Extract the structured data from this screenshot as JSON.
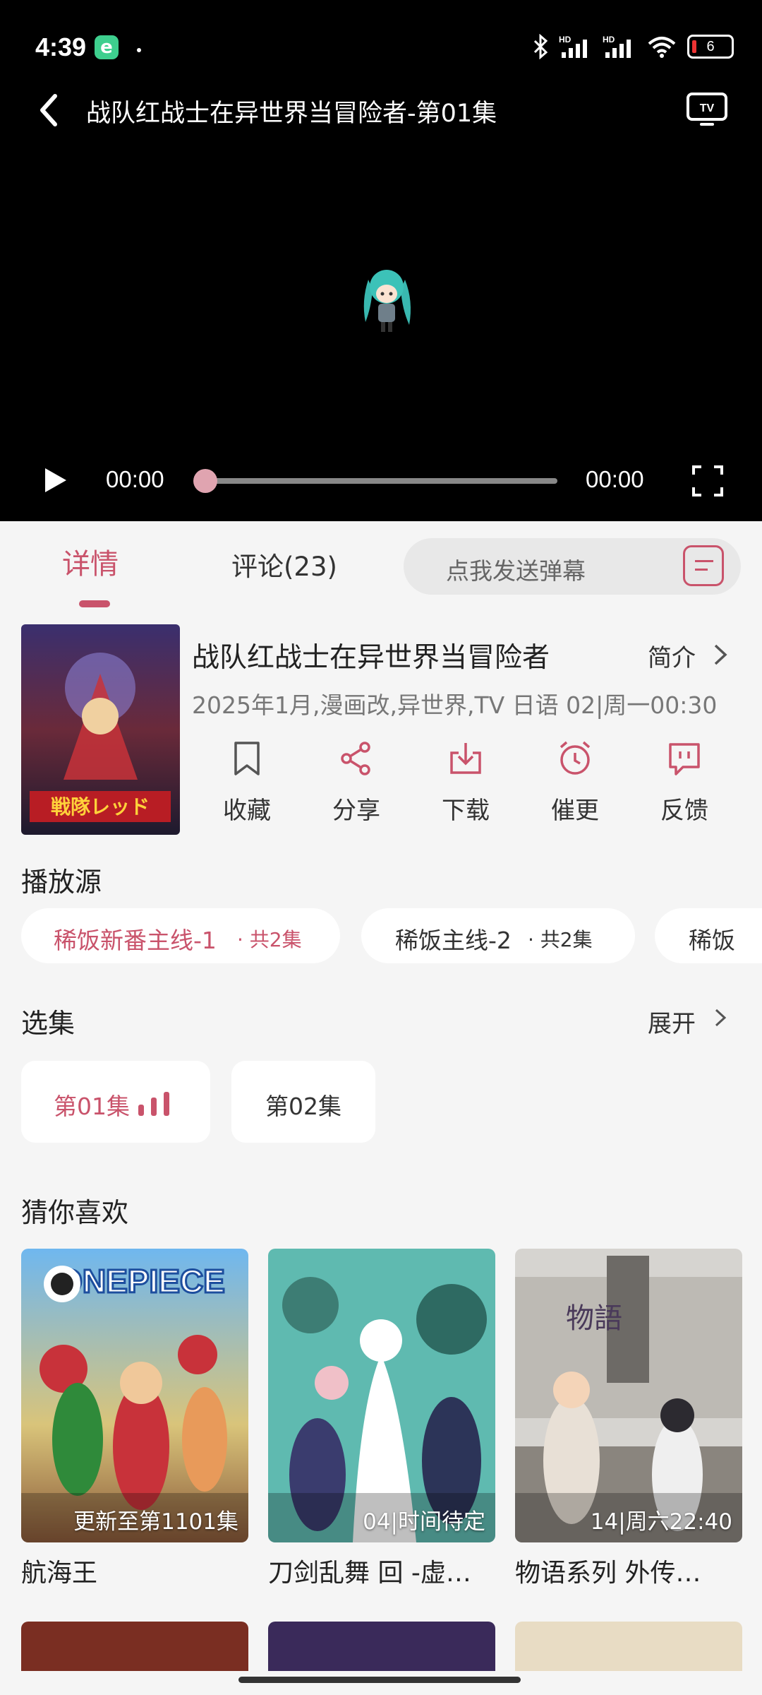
{
  "status_bar": {
    "time": "4:39",
    "app_icon_letter": "e",
    "battery": "6",
    "signal_labels": [
      "HD",
      "HD"
    ]
  },
  "player": {
    "title": "战队红战士在异世界当冒险者-第01集",
    "current_time": "00:00",
    "total_time": "00:00",
    "progress": 0
  },
  "tabs": {
    "details": "详情",
    "comments": "评论(23)",
    "danmu_placeholder": "点我发送弹幕"
  },
  "show": {
    "title": "战队红战士在异世界当冒险者",
    "intro_label": "简介",
    "meta": "2025年1月,漫画改,异世界,TV 日语 02|周一00:30",
    "poster_text": "戦隊レッド"
  },
  "actions": [
    {
      "label": "收藏",
      "icon": "bookmark-icon"
    },
    {
      "label": "分享",
      "icon": "share-icon"
    },
    {
      "label": "下载",
      "icon": "download-icon"
    },
    {
      "label": "催更",
      "icon": "alarm-clock-icon"
    },
    {
      "label": "反馈",
      "icon": "feedback-icon"
    }
  ],
  "sources": {
    "heading": "播放源",
    "items": [
      {
        "name": "稀饭新番主线-1",
        "count": "· 共2集",
        "active": true
      },
      {
        "name": "稀饭主线-2",
        "count": "· 共2集",
        "active": false
      },
      {
        "name": "稀饭",
        "count": "",
        "active": false
      }
    ]
  },
  "episodes": {
    "heading": "选集",
    "expand_label": "展开",
    "items": [
      {
        "label": "第01集",
        "active": true
      },
      {
        "label": "第02集",
        "active": false
      }
    ]
  },
  "recommend": {
    "heading": "猜你喜欢",
    "items": [
      {
        "name": "航海王",
        "badge": "更新至第1101集",
        "poster_text": "ONEPIECE"
      },
      {
        "name": "刀剑乱舞 回 -虚…",
        "badge": "04|时间待定"
      },
      {
        "name": "物语系列 外传…",
        "badge": "14|周六22:40",
        "poster_text": "物語"
      }
    ]
  },
  "colors": {
    "accent": "#c9536b",
    "player_bg": "#000000",
    "page_bg": "#f5f5f5"
  }
}
